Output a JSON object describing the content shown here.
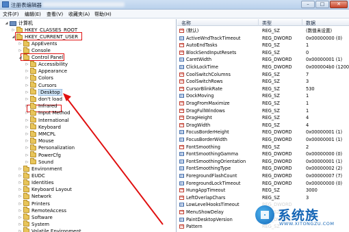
{
  "window": {
    "title": "注册表编辑器",
    "minimize": "–",
    "maximize": "□",
    "close": "✕"
  },
  "menu": [
    "文件(F)",
    "编辑(E)",
    "查看(V)",
    "收藏夹(A)",
    "帮助(H)"
  ],
  "tree": {
    "root": "计算机",
    "top": [
      {
        "label": "HKEY_CLASSES_ROOT",
        "expanded": false
      },
      {
        "label": "HKEY_CURRENT_USER",
        "expanded": true
      }
    ],
    "hkcu_children": [
      {
        "label": "AppEvents",
        "expanded": false
      },
      {
        "label": "Console",
        "expanded": false
      },
      {
        "label": "Control Panel",
        "expanded": true
      }
    ],
    "control_panel_children": [
      {
        "label": "Accessibility"
      },
      {
        "label": "Appearance"
      },
      {
        "label": "Colors"
      },
      {
        "label": "Cursors"
      },
      {
        "label": "Desktop",
        "selected": true
      },
      {
        "label": "don't load"
      },
      {
        "label": "Infrared"
      },
      {
        "label": "Input Method"
      },
      {
        "label": "International"
      },
      {
        "label": "Keyboard"
      },
      {
        "label": "MMCPL"
      },
      {
        "label": "Mouse"
      },
      {
        "label": "Personalization"
      },
      {
        "label": "PowerCfg"
      },
      {
        "label": "Sound"
      }
    ],
    "hkcu_rest": [
      {
        "label": "Environment"
      },
      {
        "label": "EUDC"
      },
      {
        "label": "Identities"
      },
      {
        "label": "Keyboard Layout"
      },
      {
        "label": "Network"
      },
      {
        "label": "Printers"
      },
      {
        "label": "RemoteAccess"
      },
      {
        "label": "Software"
      },
      {
        "label": "System"
      },
      {
        "label": "Volatile Environment"
      }
    ]
  },
  "list": {
    "columns": {
      "name": "名称",
      "type": "类型",
      "data": "数据"
    },
    "rows": [
      {
        "icon": "string",
        "name": "(默认)",
        "type": "REG_SZ",
        "data": "(数值未设置)"
      },
      {
        "icon": "binary",
        "name": "ActiveWndTrackTimeout",
        "type": "REG_DWORD",
        "data": "0x00000000 (0)"
      },
      {
        "icon": "string",
        "name": "AutoEndTasks",
        "type": "REG_SZ",
        "data": "1"
      },
      {
        "icon": "string",
        "name": "BlockSendInputResets",
        "type": "REG_SZ",
        "data": "0"
      },
      {
        "icon": "binary",
        "name": "CaretWidth",
        "type": "REG_DWORD",
        "data": "0x00000001 (1)"
      },
      {
        "icon": "binary",
        "name": "ClickLockTime",
        "type": "REG_DWORD",
        "data": "0x000004b0 (1200)"
      },
      {
        "icon": "string",
        "name": "CoolSwitchColumns",
        "type": "REG_SZ",
        "data": "7"
      },
      {
        "icon": "string",
        "name": "CoolSwitchRows",
        "type": "REG_SZ",
        "data": "3"
      },
      {
        "icon": "string",
        "name": "CursorBlinkRate",
        "type": "REG_SZ",
        "data": "530"
      },
      {
        "icon": "binary",
        "name": "DockMoving",
        "type": "REG_SZ",
        "data": "1"
      },
      {
        "icon": "string",
        "name": "DragFromMaximize",
        "type": "REG_SZ",
        "data": "1"
      },
      {
        "icon": "string",
        "name": "DragFullWindows",
        "type": "REG_SZ",
        "data": "1"
      },
      {
        "icon": "string",
        "name": "DragHeight",
        "type": "REG_SZ",
        "data": "4"
      },
      {
        "icon": "string",
        "name": "DragWidth",
        "type": "REG_SZ",
        "data": "4"
      },
      {
        "icon": "binary",
        "name": "FocusBorderHeight",
        "type": "REG_DWORD",
        "data": "0x00000001 (1)"
      },
      {
        "icon": "binary",
        "name": "FocusBorderWidth",
        "type": "REG_DWORD",
        "data": "0x00000001 (1)"
      },
      {
        "icon": "string",
        "name": "FontSmoothing",
        "type": "REG_SZ",
        "data": "2"
      },
      {
        "icon": "binary",
        "name": "FontSmoothingGamma",
        "type": "REG_DWORD",
        "data": "0x00000000 (0)"
      },
      {
        "icon": "binary",
        "name": "FontSmoothingOrientation",
        "type": "REG_DWORD",
        "data": "0x00000001 (1)"
      },
      {
        "icon": "binary",
        "name": "FontSmoothingType",
        "type": "REG_DWORD",
        "data": "0x00000002 (2)"
      },
      {
        "icon": "binary",
        "name": "ForegroundFlashCount",
        "type": "REG_DWORD",
        "data": "0x00000007 (7)"
      },
      {
        "icon": "binary",
        "name": "ForegroundLockTimeout",
        "type": "REG_DWORD",
        "data": "0x00000000 (0)"
      },
      {
        "icon": "string",
        "name": "HungAppTimeout",
        "type": "REG_SZ",
        "data": "3000"
      },
      {
        "icon": "string",
        "name": "LeftOverlapChars",
        "type": "REG_SZ",
        "data": "3"
      },
      {
        "icon": "binary",
        "name": "LowLevelHooksTimeout",
        "type": "REG_DWORD",
        "data": ""
      },
      {
        "icon": "string",
        "name": "MenuShowDelay",
        "type": "REG_SZ",
        "data": ""
      },
      {
        "icon": "binary",
        "name": "PaintDesktopVersion",
        "type": "REG_DWORD",
        "data": ""
      },
      {
        "icon": "string",
        "name": "Pattern",
        "type": "REG_SZ",
        "data": ""
      }
    ]
  },
  "watermark": {
    "brand": "系统族",
    "url": "WWW.XITONGZU.COM"
  },
  "colors": {
    "highlight": "#e01010",
    "selection": "#cde3f7",
    "brand": "#1565b5"
  }
}
